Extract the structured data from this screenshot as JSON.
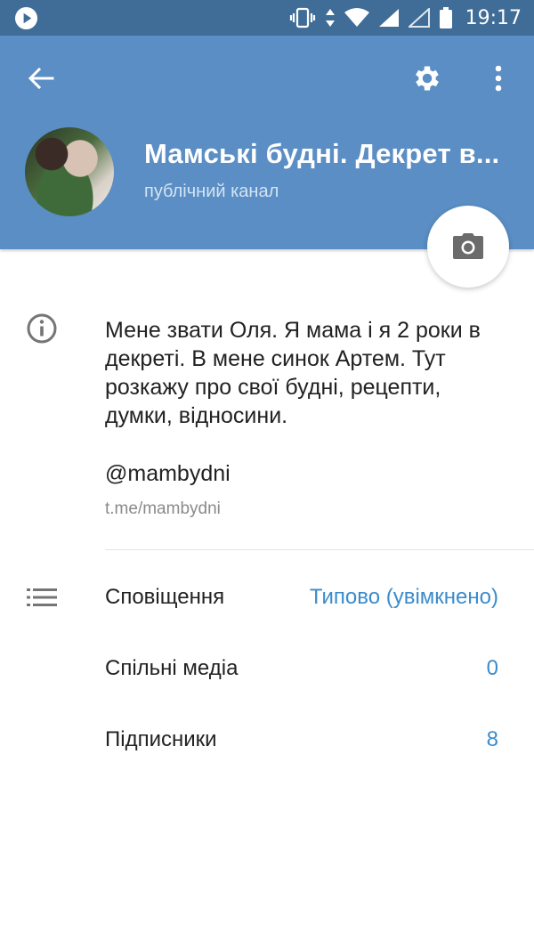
{
  "status_bar": {
    "time": "19:17",
    "icons": [
      "play-icon",
      "vibrate-icon",
      "data-arrows-icon",
      "wifi-icon",
      "signal-icon",
      "signal-empty-icon",
      "battery-icon"
    ]
  },
  "header": {
    "back_icon": "arrow-left-icon",
    "settings_icon": "gear-icon",
    "more_icon": "more-vertical-icon",
    "channel_name": "Мамські будні. Декрет в...",
    "channel_type": "публічний канал",
    "colors": {
      "header_bg": "#5a8ec4",
      "status_bg": "#3f6d97"
    }
  },
  "about": {
    "description": "Мене звати Оля. Я мама і я 2 роки в декреті. В мене синок Артем.  Тут розкажу про свої будні, рецепти, думки, відносини.",
    "username": "@mambydni",
    "link": "t.me/mambydni"
  },
  "settings": {
    "notifications_label": "Сповіщення",
    "notifications_value": "Типово (увімкнено)",
    "shared_media_label": "Спільні медіа",
    "shared_media_value": "0",
    "subscribers_label": "Підписники",
    "subscribers_value": "8",
    "accent_color": "#3a8ccc"
  }
}
